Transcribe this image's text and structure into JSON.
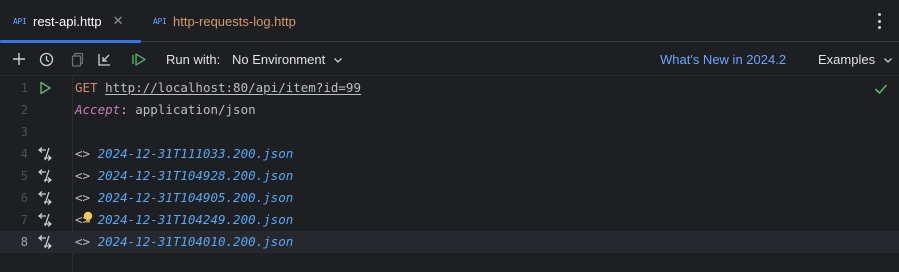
{
  "tabs": [
    {
      "icon": "API",
      "label": "rest-api.http",
      "active": true
    },
    {
      "icon": "API",
      "label": "http-requests-log.http",
      "active": false
    }
  ],
  "toolbar": {
    "run_with_label": "Run with:",
    "environment": "No Environment",
    "whats_new": "What's New in 2024.2",
    "examples": "Examples"
  },
  "editor": {
    "request_method": "GET",
    "request_url": "http://localhost:80/api/item?id=99",
    "header_name": "Accept",
    "header_sep": ": ",
    "header_value": "application/json",
    "response_prefix": "<> ",
    "line_numbers": [
      "1",
      "2",
      "3",
      "4",
      "5",
      "6",
      "7",
      "8"
    ],
    "responses": [
      "2024-12-31T111033.200.json",
      "2024-12-31T104928.200.json",
      "2024-12-31T104905.200.json",
      "2024-12-31T104249.200.json",
      "2024-12-31T104010.200.json"
    ]
  },
  "colors": {
    "accent": "#3574f0",
    "link": "#6aa5ff",
    "run_green": "#5fb865",
    "method": "#cf8e6d",
    "header": "#c77dbb",
    "response_file": "#56a8f5"
  }
}
